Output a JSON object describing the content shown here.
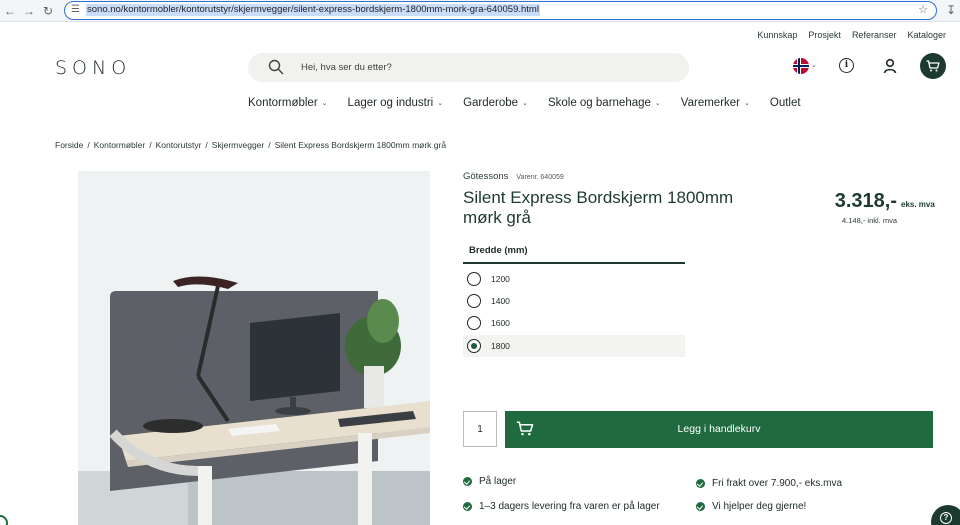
{
  "browser": {
    "url": "sono.no/kontormobler/kontorutstyr/skjermvegger/silent-express-bordskjerm-1800mm-mork-gra-640059.html"
  },
  "top_links": [
    "Kunnskap",
    "Prosjekt",
    "Referanser",
    "Kataloger"
  ],
  "logo": "SONO",
  "search": {
    "placeholder": "Hei, hva ser du etter?",
    "value": ""
  },
  "icons": {
    "search": "search-icon",
    "flag": "norway-flag-icon",
    "info": "info-icon",
    "user": "user-icon",
    "cart": "cart-icon",
    "help": "help-icon"
  },
  "main_nav": [
    {
      "label": "Kontormøbler",
      "has_dropdown": true
    },
    {
      "label": "Lager og industri",
      "has_dropdown": true
    },
    {
      "label": "Garderobe",
      "has_dropdown": true
    },
    {
      "label": "Skole og barnehage",
      "has_dropdown": true
    },
    {
      "label": "Varemerker",
      "has_dropdown": true
    },
    {
      "label": "Outlet",
      "has_dropdown": false
    }
  ],
  "breadcrumb": [
    "Forside",
    "Kontormøbler",
    "Kontorutstyr",
    "Skjermvegger",
    "Silent Express Bordskjerm 1800mm mørk grå"
  ],
  "product": {
    "brand": "Götessons",
    "sku": "Varenr. 640059",
    "title": "Silent Express Bordskjerm 1800mm mørk grå",
    "price": "3.318,-",
    "price_suffix": "eks. mva",
    "price_incl": "4.148,- inkl. mva",
    "variant_label": "Bredde (mm)",
    "variants": [
      {
        "label": "1200",
        "selected": false
      },
      {
        "label": "1400",
        "selected": false
      },
      {
        "label": "1600",
        "selected": false
      },
      {
        "label": "1800",
        "selected": true
      }
    ],
    "quantity": "1",
    "add_to_cart": "Legg i handlekurv"
  },
  "usps": {
    "stock": "På lager",
    "delivery": "1–3 dagers levering fra varen er på lager",
    "shipping": "Fri frakt over 7.900,- eks.mva",
    "help": "Vi hjelper deg gjerne!"
  },
  "colors": {
    "brand_dark": "#1d3a2f",
    "accent_green": "#1f6b3f",
    "panel_grey": "#5d6066"
  }
}
